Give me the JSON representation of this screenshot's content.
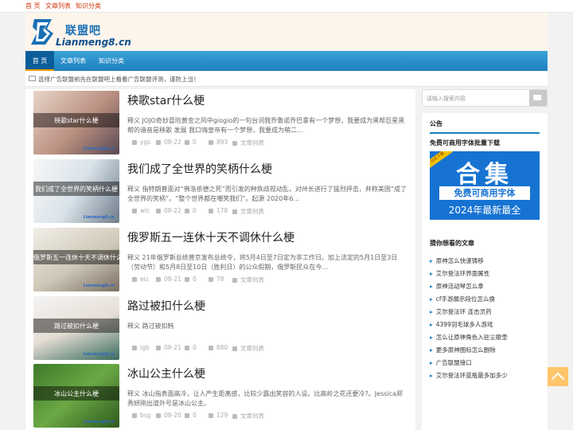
{
  "topbar": {
    "links": [
      "首 页",
      "文章列表",
      "知识分类"
    ]
  },
  "header": {
    "logo_cn": "联盟吧",
    "logo_en": "Lianmeng8.cn"
  },
  "nav": {
    "items": [
      "首 页",
      "文章列表",
      "知识分类"
    ],
    "active": "首 页"
  },
  "notice": {
    "text": "选择广告联盟前先在联盟吧上看看广告联盟评测，谨防上当！"
  },
  "posts": [
    {
      "title": "秧歌star什么梗",
      "thumb_caption": "秧歌star什么梗",
      "excerpt": "释义 JOJO奇妙冒险黄金之风中giogio的一句台词我乔鲁诺乔巴拿有一个梦想，我要成为黑帮巨星黑帮的谐音是秧歌 发展 我口嗨皇帝有一个梦想，我要成为萌二...",
      "author": "ygs",
      "date": "08-22",
      "comments": "0",
      "views": "893",
      "category": "文章列表"
    },
    {
      "title": "我们成了全世界的笑柄什么梗",
      "thumb_caption": "我们成了全世界的笑柄什么梗",
      "excerpt": "释义 指特朗普面对“佛洛依德之死”而引发的种族歧视动乱，对州长进行了猛烈抨击，并称美国“成了全世界的笑柄”。“整个世界都在嘲笑我们”。起源 2020年6...",
      "author": "wlc",
      "date": "08-22",
      "comments": "0",
      "views": "178",
      "category": "文章列表"
    },
    {
      "title": "俄罗斯五一连休十天不调休什么梗",
      "thumb_caption": "俄罗斯五一连休十天不调休什么梗",
      "excerpt": "释义 21年俄罗斯总统普京发布总统令，将5月4日至7日定为非工作日。加上法定的5月1日至3日（劳动节）和5月8日至10日（胜利日）的公众假期，俄罗斯民众在今...",
      "author": "eis",
      "date": "08-21",
      "comments": "0",
      "views": "78",
      "category": "文章列表"
    },
    {
      "title": "路过被扣什么梗",
      "thumb_caption": "路过被扣什么梗",
      "excerpt": "释义 路过被扣韩",
      "author": "lgb",
      "date": "08-21",
      "comments": "0",
      "views": "880",
      "category": "文章列表"
    },
    {
      "title": "冰山公主什么梗",
      "thumb_caption": "冰山公主什么梗",
      "excerpt": "释义 冰山指表面高冷，让人产生距离感，比较少露出笑容的人设。比高岭之花还要冷?。Jessica郑秀妍刚出道外号是冰山公主。",
      "author": "bsg",
      "date": "08-20",
      "comments": "0",
      "views": "129",
      "category": "文章列表"
    }
  ],
  "thumb_watermark": "Lianmeng8.cn",
  "sidebar": {
    "search_placeholder": "请输入搜索内容",
    "notice_title": "公告",
    "notice_link": "免费可商用字体批量下载",
    "banner": {
      "ribbon": "点击下载",
      "big": "合集",
      "mid": "免费可商用字体",
      "low": "2024年最新最全"
    },
    "guess_title": "猜你想看的文章",
    "guess_items": [
      "原神怎么快速铸移",
      "艾尔登法环界面属性",
      "原神活动琴怎么拿",
      "cf手游展示段位怎么换",
      "艾尔登法环 连击灵药",
      "4399羽毛球多人游戏",
      "怎么让原神角色入驻尘歌壶",
      "更多原神图标怎么删除",
      "广告联盟接口",
      "艾尔登法环蓝瓶最多加多少"
    ]
  },
  "colors": {
    "accent": "#1f7fbf",
    "topbar_link": "#d4380d",
    "back_to_top": "#ffc56b"
  }
}
